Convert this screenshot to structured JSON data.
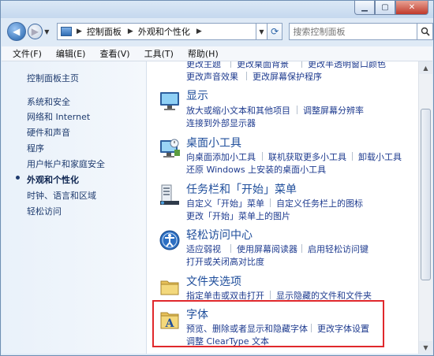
{
  "address": {
    "crumbs": [
      "控制面板",
      "外观和个性化"
    ],
    "search_placeholder": "搜索控制面板"
  },
  "menu": [
    "文件(F)",
    "编辑(E)",
    "查看(V)",
    "工具(T)",
    "帮助(H)"
  ],
  "sidebar": {
    "home": "控制面板主页",
    "items": [
      "系统和安全",
      "网络和 Internet",
      "硬件和声音",
      "程序",
      "用户帐户和家庭安全",
      "外观和个性化",
      "时钟、语言和区域",
      "轻松访问"
    ],
    "current_index": 5
  },
  "content": {
    "partial_top": {
      "line1": [
        "更改主题",
        "更改桌面背景",
        "更改半透明窗口颜色"
      ],
      "line2": [
        "更改声音效果",
        "更改屏幕保护程序"
      ]
    },
    "categories": [
      {
        "title": "显示",
        "links": [
          [
            "放大或缩小文本和其他项目",
            "调整屏幕分辨率"
          ],
          [
            "连接到外部显示器"
          ]
        ]
      },
      {
        "title": "桌面小工具",
        "links": [
          [
            "向桌面添加小工具",
            "联机获取更多小工具",
            "卸载小工具"
          ],
          [
            "还原 Windows 上安装的桌面小工具"
          ]
        ]
      },
      {
        "title": "任务栏和「开始」菜单",
        "links": [
          [
            "自定义「开始」菜单",
            "自定义任务栏上的图标"
          ],
          [
            "更改「开始」菜单上的图片"
          ]
        ]
      },
      {
        "title": "轻松访问中心",
        "links": [
          [
            "适应弱视",
            "使用屏幕阅读器",
            "启用轻松访问键"
          ],
          [
            "打开或关闭高对比度"
          ]
        ]
      },
      {
        "title": "文件夹选项",
        "links": [
          [
            "指定单击或双击打开",
            "显示隐藏的文件和文件夹"
          ]
        ]
      },
      {
        "title": "字体",
        "links": [
          [
            "预览、删除或者显示和隐藏字体",
            "更改字体设置"
          ],
          [
            "调整 ClearType 文本"
          ]
        ]
      }
    ]
  }
}
